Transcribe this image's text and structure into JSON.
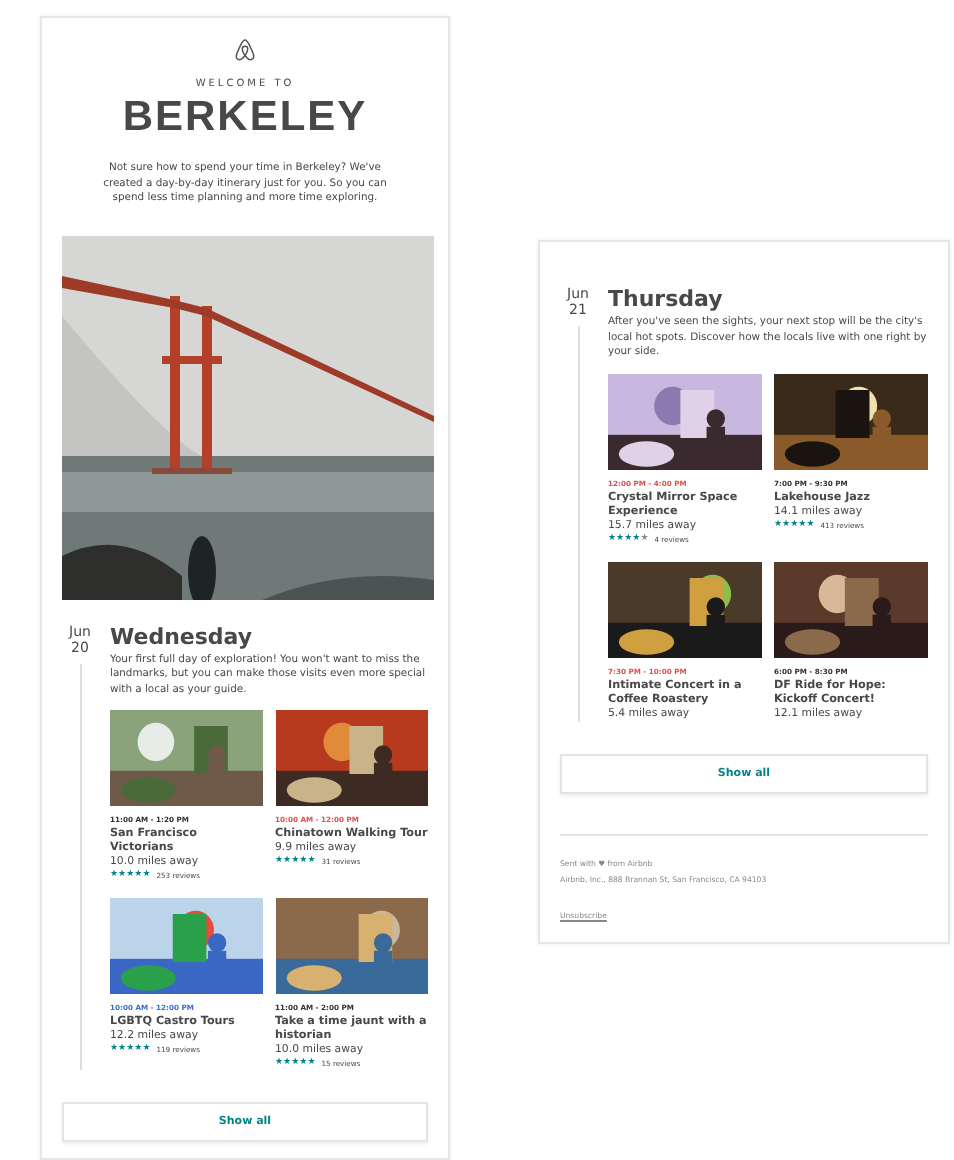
{
  "welcome": {
    "kicker": "WELCOME TO",
    "city": "BERKELEY",
    "intro": "Not sure how to spend your time in Berkeley? We've created a day-by-day itinerary just for you. So you can spend less time planning and more time exploring."
  },
  "days": [
    {
      "month": "Jun",
      "day": "20",
      "weekday": "Wednesday",
      "description": "Your first full day of exploration! You won't want to miss the landmarks, but you can make those visits even more special with a local as your guide.",
      "show_all": "Show all",
      "cards": [
        {
          "time": "11:00 AM - 1:20 PM",
          "color": "#333333",
          "title": "San Francisco Victorians",
          "distance": "10.0 miles away",
          "stars": 5,
          "reviews": "253 reviews"
        },
        {
          "time": "10:00 AM - 12:00 PM",
          "color": "#d9534f",
          "title": "Chinatown Walking Tour",
          "distance": "9.9 miles away",
          "stars": 5,
          "reviews": "31 reviews"
        },
        {
          "time": "10:00 AM - 12:00 PM",
          "color": "#3b6fd4",
          "title": "LGBTQ Castro Tours",
          "distance": "12.2 miles away",
          "stars": 5,
          "reviews": "119 reviews"
        },
        {
          "time": "11:00 AM - 2:00 PM",
          "color": "#333333",
          "title": "Take a time jaunt with a historian",
          "distance": "10.0 miles away",
          "stars": 5,
          "reviews": "15 reviews"
        }
      ]
    },
    {
      "month": "Jun",
      "day": "21",
      "weekday": "Thursday",
      "description": "After you've seen the sights, your next stop will be the city's local hot spots. Discover how the locals live with one right by your side.",
      "show_all": "Show all",
      "cards": [
        {
          "time": "12:00 PM - 4:00 PM",
          "color": "#d9534f",
          "title": "Crystal Mirror Space Experience",
          "distance": "15.7 miles away",
          "stars": 4,
          "reviews": "4 reviews"
        },
        {
          "time": "7:00 PM - 9:30 PM",
          "color": "#333333",
          "title": "Lakehouse Jazz",
          "distance": "14.1 miles away",
          "stars": 5,
          "reviews": "413 reviews"
        },
        {
          "time": "7:30 PM - 10:00 PM",
          "color": "#d9534f",
          "title": "Intimate Concert in a Coffee Roastery",
          "distance": "5.4 miles away"
        },
        {
          "time": "6:00 PM - 8:30 PM",
          "color": "#333333",
          "title": "DF Ride for Hope: Kickoff Concert!",
          "distance": "12.1 miles away"
        }
      ]
    }
  ],
  "footer": {
    "sent": "Sent with ♥ from Airbnb",
    "address": "Airbnb, Inc., 888 Brannan St, San Francisco, CA 94103",
    "unsubscribe": "Unsubscribe"
  }
}
